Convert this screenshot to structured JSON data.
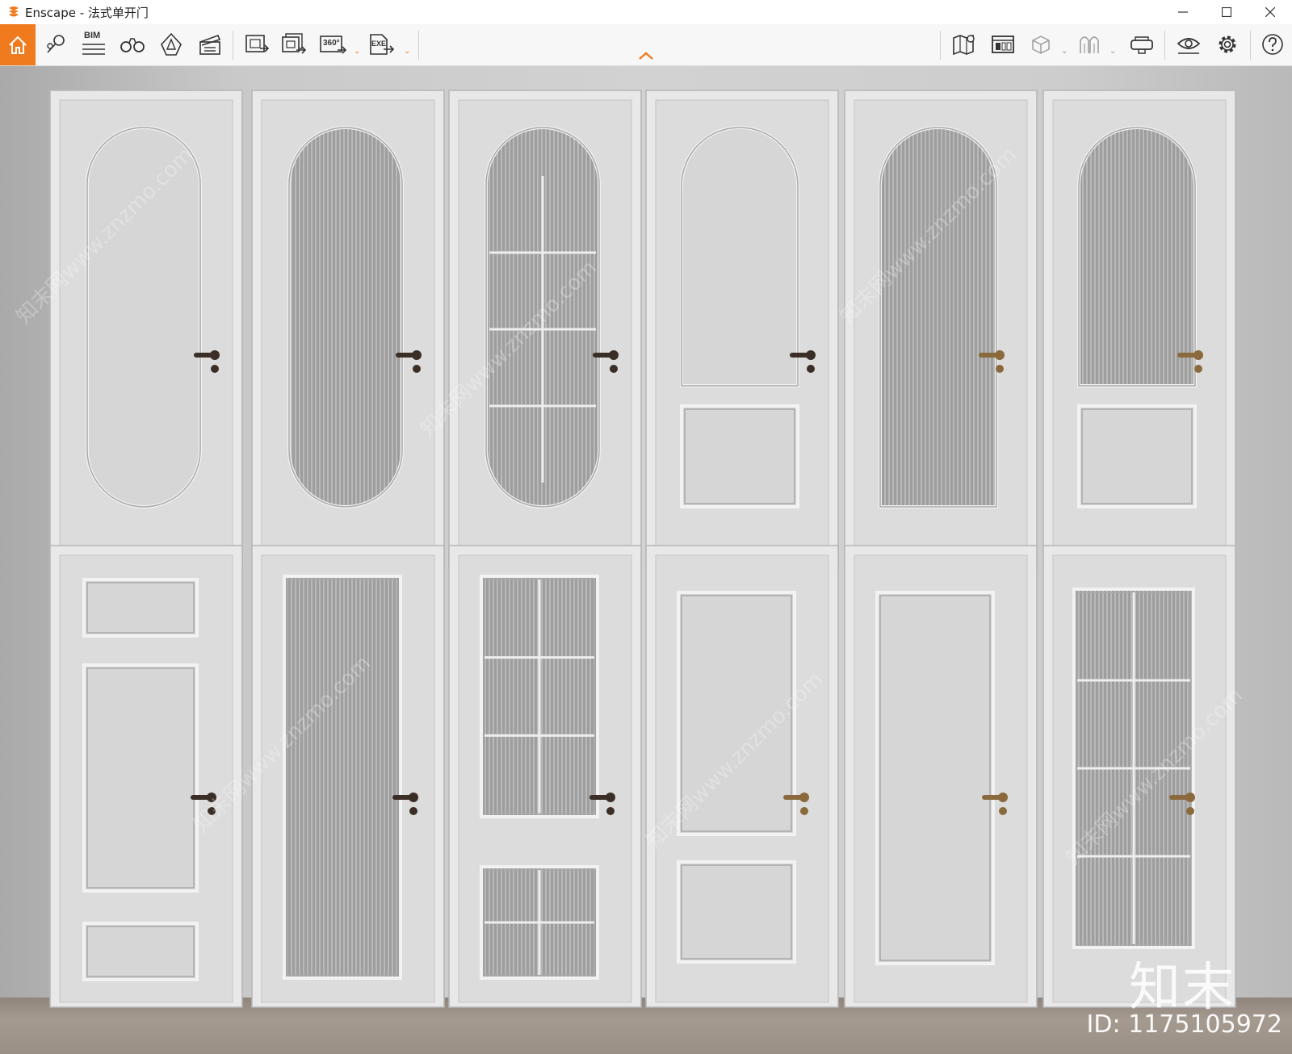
{
  "window": {
    "title": "Enscape - 法式单开门",
    "brand_color": "#f07b1f"
  },
  "toolbar": {
    "left": [
      {
        "name": "home",
        "icon": "home-icon"
      },
      {
        "name": "views",
        "icon": "map-pin-icon"
      },
      {
        "name": "bim",
        "icon": "bim-icon",
        "label": "BIM"
      },
      {
        "name": "walk-mode",
        "icon": "binoculars-icon"
      },
      {
        "name": "assets",
        "icon": "asset-library-icon"
      },
      {
        "name": "video-editor",
        "icon": "clapperboard-icon"
      },
      {
        "name": "screenshot",
        "icon": "render-image-icon"
      },
      {
        "name": "batch-render",
        "icon": "batch-render-icon"
      },
      {
        "name": "panorama",
        "icon": "panorama-360-icon",
        "label": "360°"
      },
      {
        "name": "export-exe",
        "icon": "export-exe-icon",
        "label": "EXE"
      }
    ],
    "right": [
      {
        "name": "map",
        "icon": "map-icon"
      },
      {
        "name": "minimap",
        "icon": "minimap-icon"
      },
      {
        "name": "objects",
        "icon": "cube-icon"
      },
      {
        "name": "materials",
        "icon": "material-icon"
      },
      {
        "name": "vr",
        "icon": "vr-headset-icon"
      },
      {
        "name": "visual-settings",
        "icon": "eye-icon"
      },
      {
        "name": "settings",
        "icon": "gear-icon"
      },
      {
        "name": "help",
        "icon": "help-icon"
      }
    ]
  },
  "watermark": {
    "logo": "知末",
    "id": "ID: 1175105972",
    "diagonal": "知末网www.znzmo.com"
  }
}
